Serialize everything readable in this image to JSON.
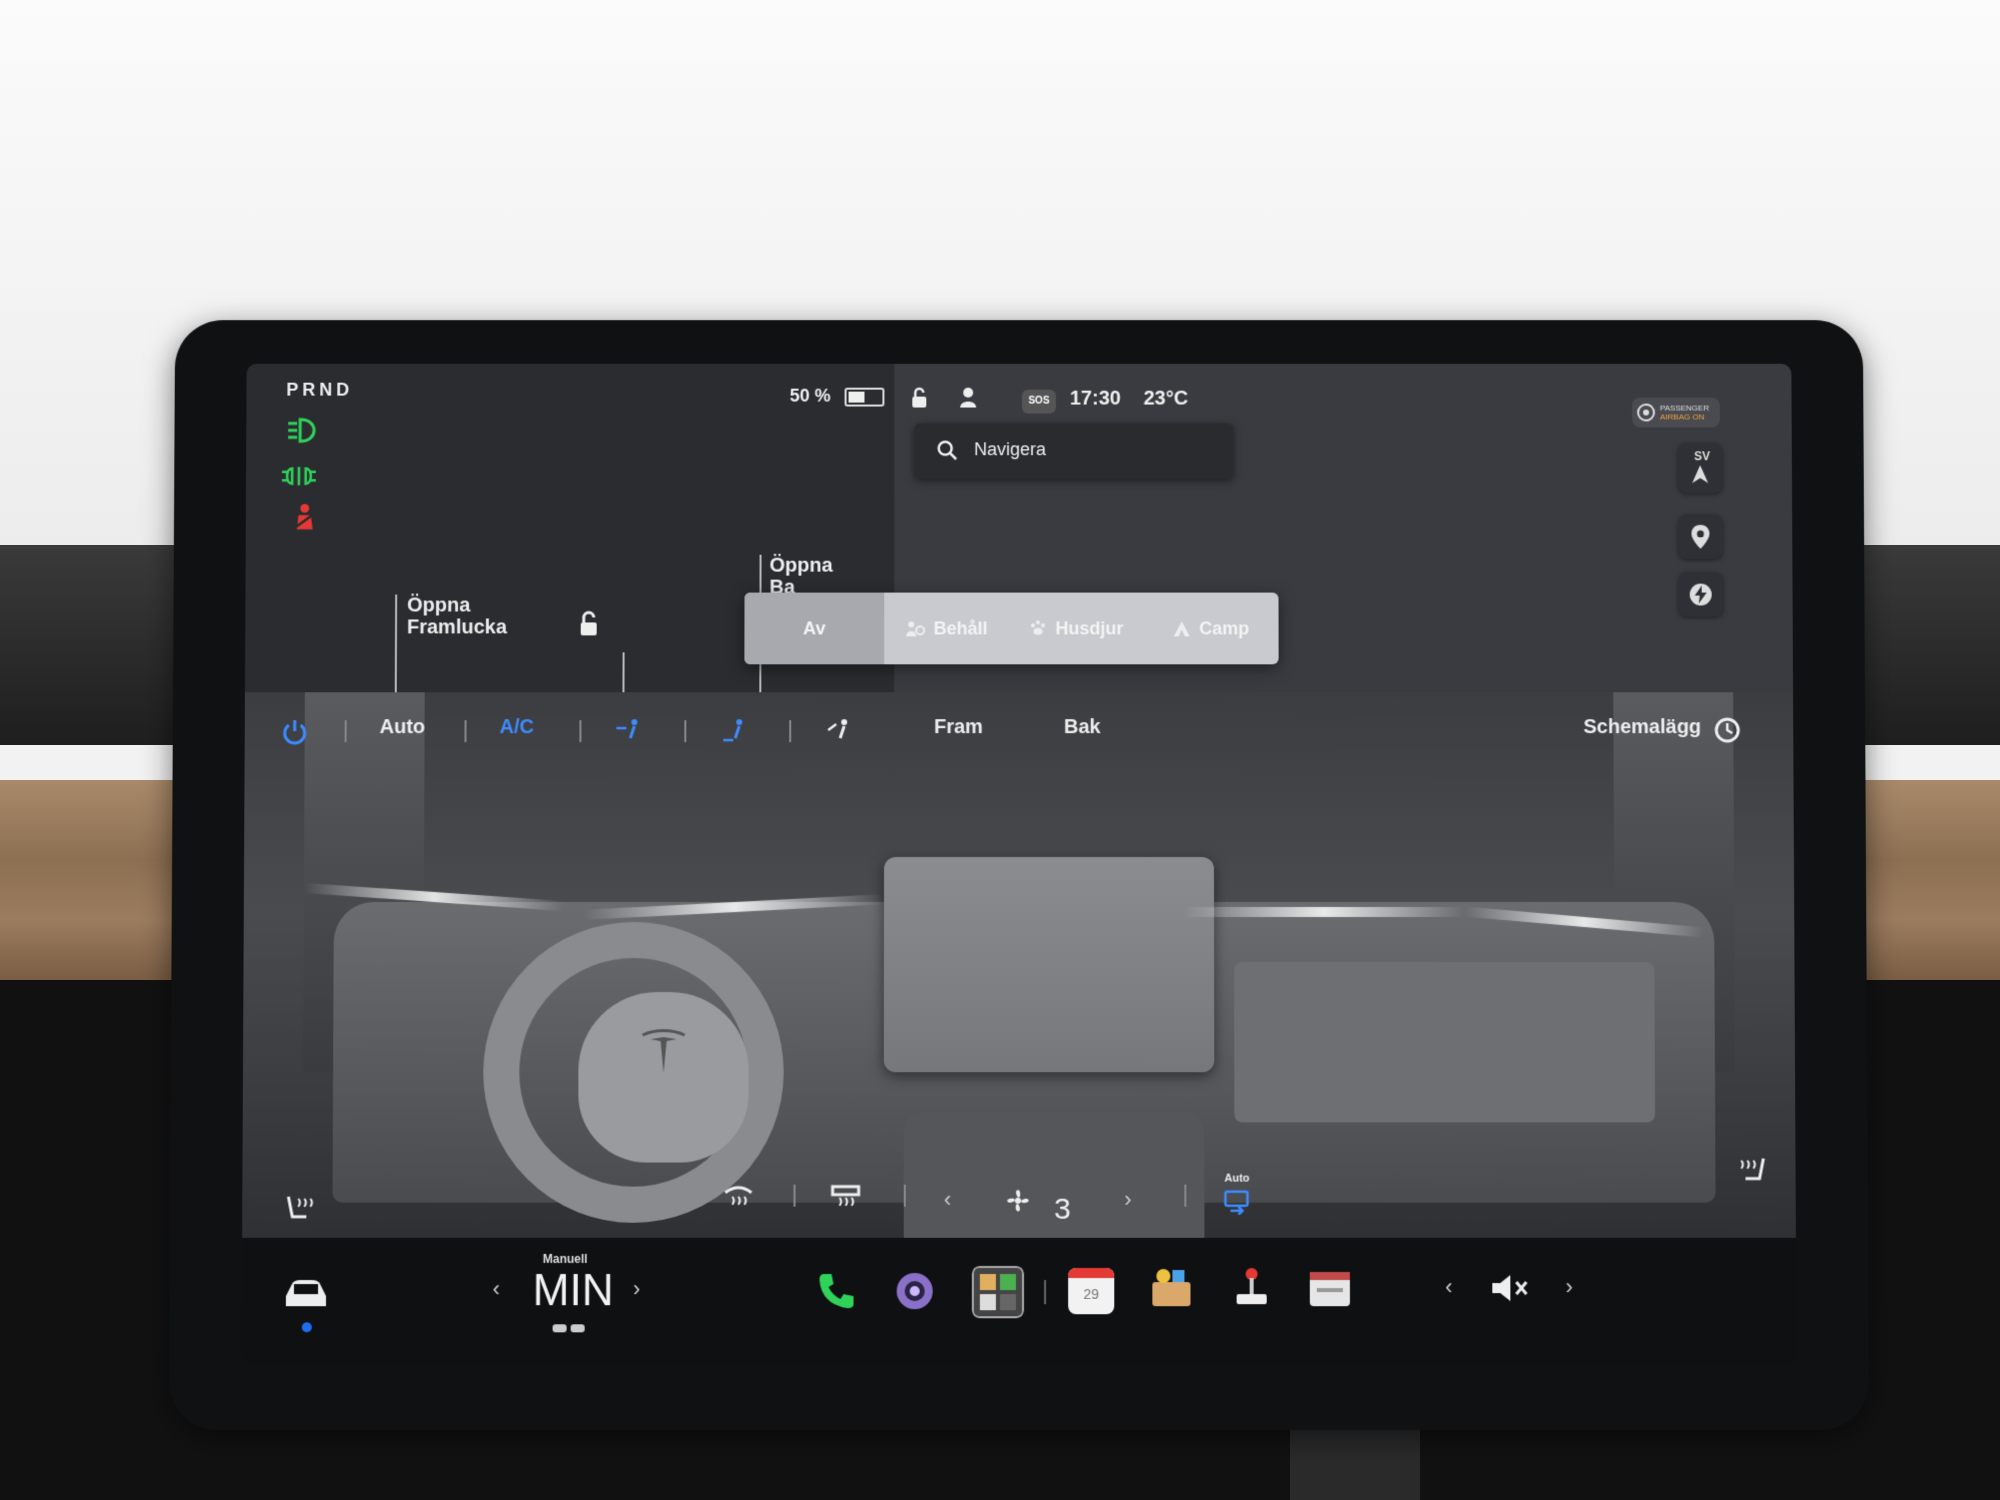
{
  "gear": "PRND",
  "battery": "50 %",
  "time": "17:30",
  "temperature": "23°C",
  "sos_label": "SOS",
  "airbag_status": {
    "line1": "PASSENGER",
    "line2": "AIRBAG ON"
  },
  "search": {
    "placeholder": "Navigera"
  },
  "map_compass": "SV",
  "vehicle": {
    "front_trunk": "Öppna Framlucka",
    "back_trunk_line1": "Öppna",
    "back_trunk_line2": "Ba"
  },
  "climate_modes": [
    {
      "label": "Av",
      "icon": "",
      "active": true
    },
    {
      "label": "Behåll",
      "icon": "fan-person-icon",
      "active": false
    },
    {
      "label": "Husdjur",
      "icon": "paw-icon",
      "active": false
    },
    {
      "label": "Camp",
      "icon": "tent-icon",
      "active": false
    }
  ],
  "climate": {
    "auto": "Auto",
    "ac": "A/C",
    "front": "Fram",
    "rear": "Bak",
    "schedule": "Schemalägg",
    "fan_speed": "3",
    "recirc_auto": "Auto"
  },
  "dock": {
    "temp_mode": "Manuell",
    "temp_value": "MIN",
    "calendar_day": "29"
  },
  "colors": {
    "accent_blue": "#3d8bff",
    "headlight_green": "#2fd35a",
    "seatbelt_red": "#e53935"
  }
}
